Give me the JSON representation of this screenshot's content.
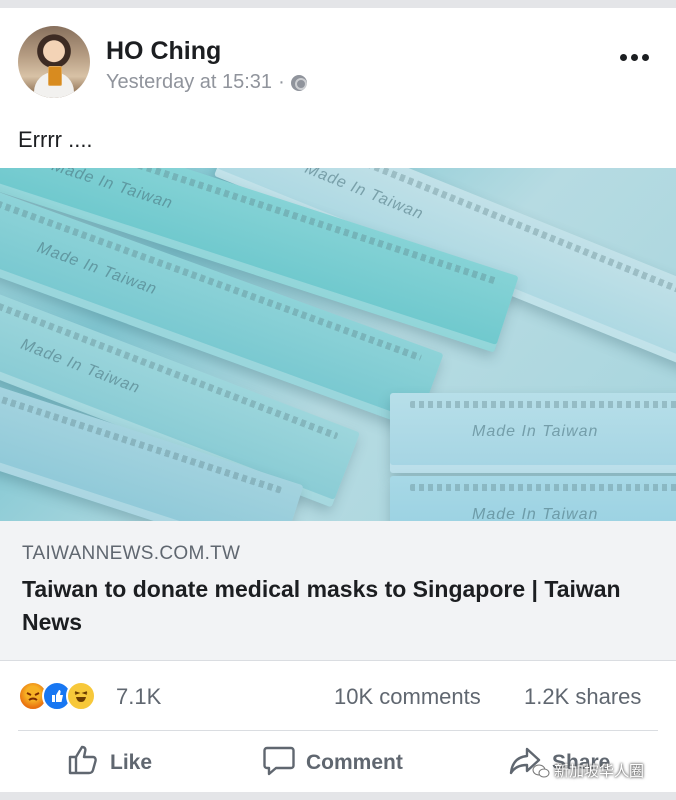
{
  "post": {
    "author": "HO Ching",
    "timestamp": "Yesterday at 15:31",
    "separator": "·",
    "privacy_icon": "globe-icon",
    "text": "Errrr ...."
  },
  "photo": {
    "mask_labels": [
      "Made In Taiwan",
      "Made In Taiwan",
      "Made In Taiwan",
      "Made In Taiwan",
      "Made In Taiwan",
      "Made In Taiwan"
    ]
  },
  "link_preview": {
    "domain": "TAIWANNEWS.COM.TW",
    "title": "Taiwan to donate medical masks to Singapore | Taiwan News"
  },
  "engagement": {
    "reaction_icons": [
      "angry-reaction-icon",
      "like-reaction-icon",
      "haha-reaction-icon"
    ],
    "reaction_count": "7.1K",
    "comments": "10K comments",
    "shares": "1.2K shares"
  },
  "actions": {
    "like": "Like",
    "comment": "Comment",
    "share": "Share"
  },
  "watermark": "新加坡华人圈",
  "colors": {
    "link_blue": "#1877f2",
    "secondary_text": "#606770",
    "background": "#e4e5e8"
  }
}
